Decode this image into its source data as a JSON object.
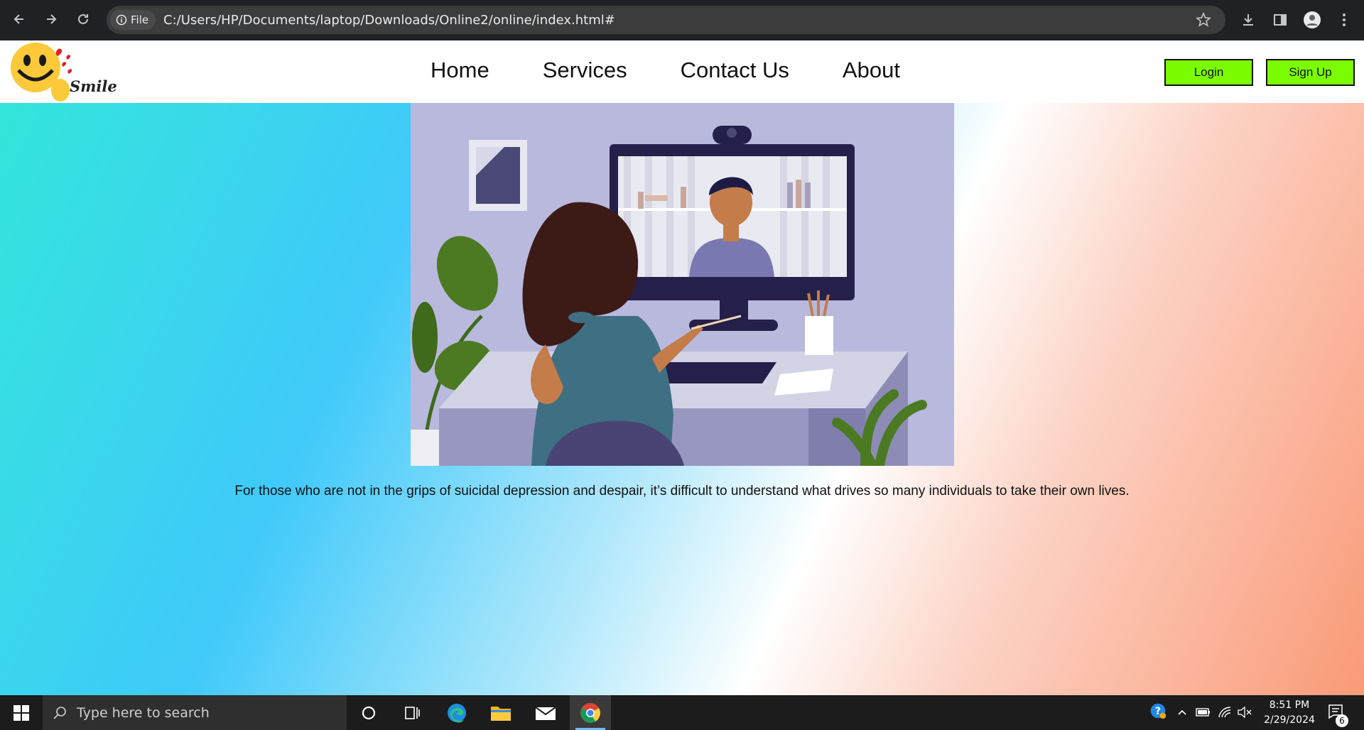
{
  "browser": {
    "file_chip_label": "File",
    "url": "C:/Users/HP/Documents/laptop/Downloads/Online2/online/index.html#"
  },
  "site": {
    "logo_text": "Smile",
    "nav": [
      "Home",
      "Services",
      "Contact Us",
      "About"
    ],
    "login_label": "Login",
    "signup_label": "Sign Up",
    "button_color": "#7cfc00"
  },
  "main": {
    "caption": "For those who are not in the grips of suicidal depression and despair, it’s difficult to understand what drives so many individuals to take their own lives."
  },
  "taskbar": {
    "search_placeholder": "Type here to search",
    "time": "8:51 PM",
    "date": "2/29/2024",
    "notification_count": "6"
  }
}
